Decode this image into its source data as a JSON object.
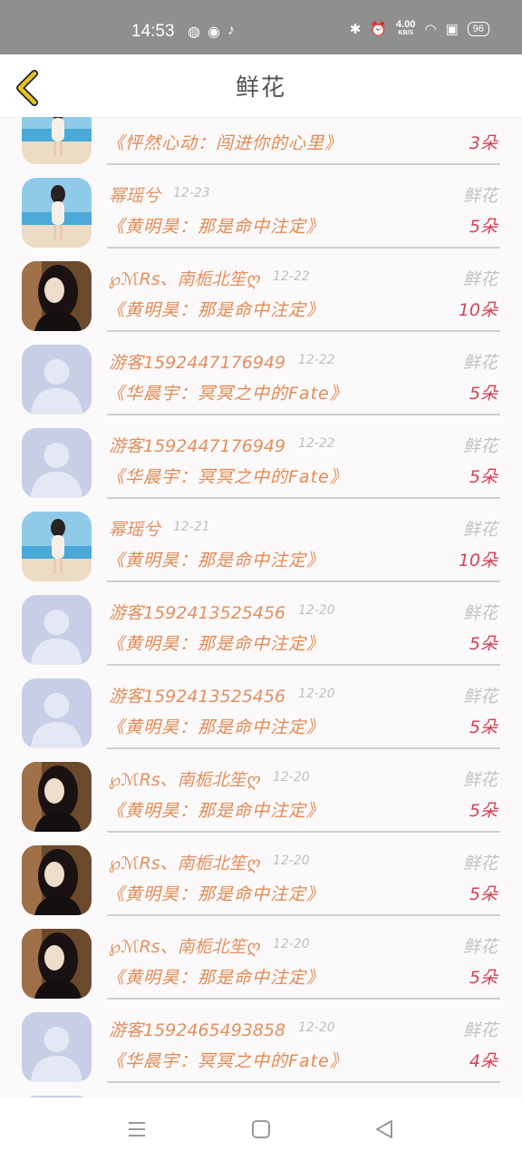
{
  "status_bar": {
    "time": "14:53",
    "net_speed": "4.00",
    "net_unit": "KB/S",
    "battery": "96"
  },
  "header": {
    "title": "鲜花"
  },
  "records": [
    {
      "user": "",
      "date": "",
      "gift": "",
      "song": "《怦然心动：闯进你的心里》",
      "count": "3朵",
      "avatar": "beach-girl",
      "partial": true
    },
    {
      "user": "幂瑶兮",
      "date": "12-23",
      "gift": "鲜花",
      "song": "《黄明昊：那是命中注定》",
      "count": "5朵",
      "avatar": "beach-girl"
    },
    {
      "user": "℘ℳRs、南栀北笙ღ",
      "date": "12-22",
      "gift": "鲜花",
      "song": "《黄明昊：那是命中注定》",
      "count": "10朵",
      "avatar": "dark-hair-girl"
    },
    {
      "user": "游客1592447176949",
      "date": "12-22",
      "gift": "鲜花",
      "song": "《华晨宇：冥冥之中的Fate》",
      "count": "5朵",
      "avatar": "default"
    },
    {
      "user": "游客1592447176949",
      "date": "12-22",
      "gift": "鲜花",
      "song": "《华晨宇：冥冥之中的Fate》",
      "count": "5朵",
      "avatar": "default"
    },
    {
      "user": "幂瑶兮",
      "date": "12-21",
      "gift": "鲜花",
      "song": "《黄明昊：那是命中注定》",
      "count": "10朵",
      "avatar": "beach-girl"
    },
    {
      "user": "游客1592413525456",
      "date": "12-20",
      "gift": "鲜花",
      "song": "《黄明昊：那是命中注定》",
      "count": "5朵",
      "avatar": "default"
    },
    {
      "user": "游客1592413525456",
      "date": "12-20",
      "gift": "鲜花",
      "song": "《黄明昊：那是命中注定》",
      "count": "5朵",
      "avatar": "default"
    },
    {
      "user": "℘ℳRs、南栀北笙ღ",
      "date": "12-20",
      "gift": "鲜花",
      "song": "《黄明昊：那是命中注定》",
      "count": "5朵",
      "avatar": "dark-hair-girl"
    },
    {
      "user": "℘ℳRs、南栀北笙ღ",
      "date": "12-20",
      "gift": "鲜花",
      "song": "《黄明昊：那是命中注定》",
      "count": "5朵",
      "avatar": "dark-hair-girl"
    },
    {
      "user": "℘ℳRs、南栀北笙ღ",
      "date": "12-20",
      "gift": "鲜花",
      "song": "《黄明昊：那是命中注定》",
      "count": "5朵",
      "avatar": "dark-hair-girl"
    },
    {
      "user": "游客1592465493858",
      "date": "12-20",
      "gift": "鲜花",
      "song": "《华晨宇：冥冥之中的Fate》",
      "count": "4朵",
      "avatar": "default"
    }
  ],
  "colors": {
    "accent_back": "#e8c21a",
    "username": "#e3905f",
    "count": "#d64058"
  },
  "icons": {
    "back": "chevron-left-icon",
    "menu": "menu-icon",
    "home": "home-square-icon",
    "back_nav": "triangle-back-icon"
  }
}
